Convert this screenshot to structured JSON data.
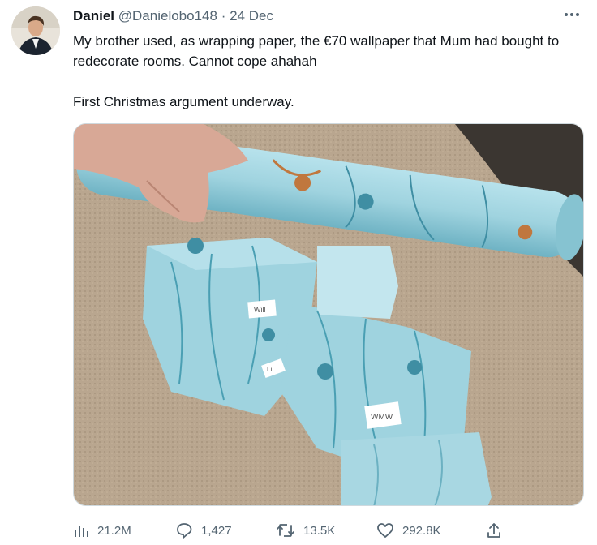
{
  "tweet": {
    "author_name": "Daniel",
    "author_handle": "@Danielobo148",
    "separator": "·",
    "date": "24 Dec",
    "text_line1": "My brother used, as wrapping paper, the €70 wallpaper that Mum had bought to redecorate rooms. Cannot cope ahahah",
    "text_line2": "First Christmas argument underway.",
    "wrapper_labels": [
      "Will",
      "Li",
      "WMW"
    ]
  },
  "actions": {
    "views": "21.2M",
    "replies": "1,427",
    "retweets": "13.5K",
    "likes": "292.8K"
  },
  "colors": {
    "text": "#0f1419",
    "secondary": "#536471",
    "wallpaper": "#9fd3df",
    "carpet": "#b9a68f"
  },
  "icons": [
    "more-icon",
    "views-icon",
    "reply-icon",
    "retweet-icon",
    "like-icon",
    "share-icon"
  ]
}
